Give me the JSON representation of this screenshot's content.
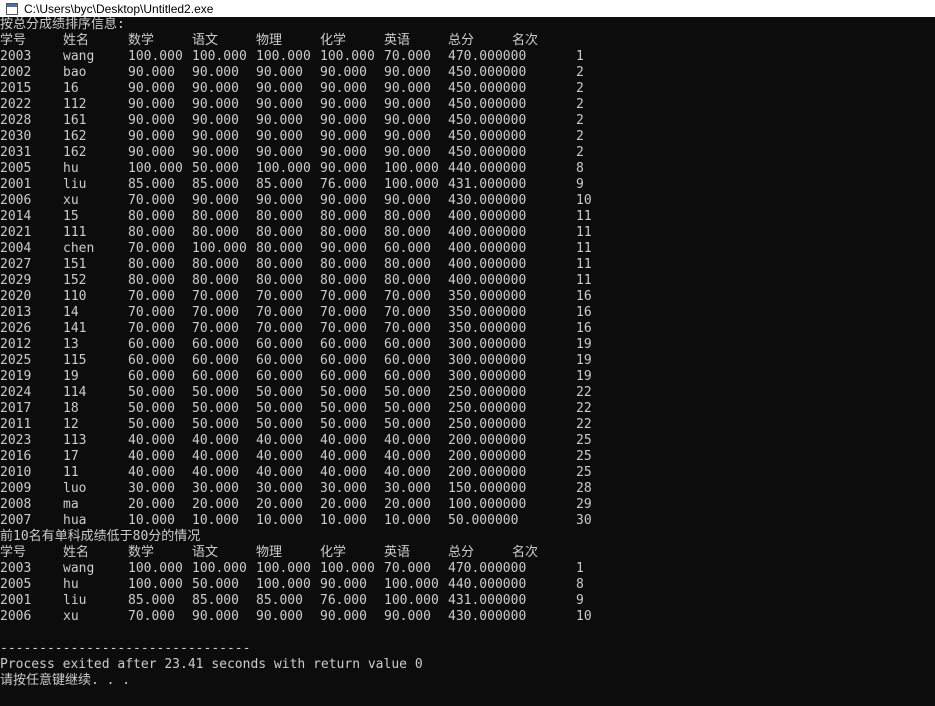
{
  "window": {
    "title": "C:\\Users\\byc\\Desktop\\Untitled2.exe"
  },
  "console": {
    "heading_all": "按总分成绩排序信息:",
    "columns": [
      "学号",
      "姓名",
      "数学",
      "语文",
      "物理",
      "化学",
      "英语",
      "总分",
      "名次"
    ],
    "rows_all": [
      [
        "2003",
        "wang",
        "100.000",
        "100.000",
        "100.000",
        "100.000",
        "70.000",
        "470.000000",
        "1"
      ],
      [
        "2002",
        "bao",
        "90.000",
        "90.000",
        "90.000",
        "90.000",
        "90.000",
        "450.000000",
        "2"
      ],
      [
        "2015",
        "16",
        "90.000",
        "90.000",
        "90.000",
        "90.000",
        "90.000",
        "450.000000",
        "2"
      ],
      [
        "2022",
        "112",
        "90.000",
        "90.000",
        "90.000",
        "90.000",
        "90.000",
        "450.000000",
        "2"
      ],
      [
        "2028",
        "161",
        "90.000",
        "90.000",
        "90.000",
        "90.000",
        "90.000",
        "450.000000",
        "2"
      ],
      [
        "2030",
        "162",
        "90.000",
        "90.000",
        "90.000",
        "90.000",
        "90.000",
        "450.000000",
        "2"
      ],
      [
        "2031",
        "162",
        "90.000",
        "90.000",
        "90.000",
        "90.000",
        "90.000",
        "450.000000",
        "2"
      ],
      [
        "2005",
        "hu",
        "100.000",
        "50.000",
        "100.000",
        "90.000",
        "100.000",
        "440.000000",
        "8"
      ],
      [
        "2001",
        "liu",
        "85.000",
        "85.000",
        "85.000",
        "76.000",
        "100.000",
        "431.000000",
        "9"
      ],
      [
        "2006",
        "xu",
        "70.000",
        "90.000",
        "90.000",
        "90.000",
        "90.000",
        "430.000000",
        "10"
      ],
      [
        "2014",
        "15",
        "80.000",
        "80.000",
        "80.000",
        "80.000",
        "80.000",
        "400.000000",
        "11"
      ],
      [
        "2021",
        "111",
        "80.000",
        "80.000",
        "80.000",
        "80.000",
        "80.000",
        "400.000000",
        "11"
      ],
      [
        "2004",
        "chen",
        "70.000",
        "100.000",
        "80.000",
        "90.000",
        "60.000",
        "400.000000",
        "11"
      ],
      [
        "2027",
        "151",
        "80.000",
        "80.000",
        "80.000",
        "80.000",
        "80.000",
        "400.000000",
        "11"
      ],
      [
        "2029",
        "152",
        "80.000",
        "80.000",
        "80.000",
        "80.000",
        "80.000",
        "400.000000",
        "11"
      ],
      [
        "2020",
        "110",
        "70.000",
        "70.000",
        "70.000",
        "70.000",
        "70.000",
        "350.000000",
        "16"
      ],
      [
        "2013",
        "14",
        "70.000",
        "70.000",
        "70.000",
        "70.000",
        "70.000",
        "350.000000",
        "16"
      ],
      [
        "2026",
        "141",
        "70.000",
        "70.000",
        "70.000",
        "70.000",
        "70.000",
        "350.000000",
        "16"
      ],
      [
        "2012",
        "13",
        "60.000",
        "60.000",
        "60.000",
        "60.000",
        "60.000",
        "300.000000",
        "19"
      ],
      [
        "2025",
        "115",
        "60.000",
        "60.000",
        "60.000",
        "60.000",
        "60.000",
        "300.000000",
        "19"
      ],
      [
        "2019",
        "19",
        "60.000",
        "60.000",
        "60.000",
        "60.000",
        "60.000",
        "300.000000",
        "19"
      ],
      [
        "2024",
        "114",
        "50.000",
        "50.000",
        "50.000",
        "50.000",
        "50.000",
        "250.000000",
        "22"
      ],
      [
        "2017",
        "18",
        "50.000",
        "50.000",
        "50.000",
        "50.000",
        "50.000",
        "250.000000",
        "22"
      ],
      [
        "2011",
        "12",
        "50.000",
        "50.000",
        "50.000",
        "50.000",
        "50.000",
        "250.000000",
        "22"
      ],
      [
        "2023",
        "113",
        "40.000",
        "40.000",
        "40.000",
        "40.000",
        "40.000",
        "200.000000",
        "25"
      ],
      [
        "2016",
        "17",
        "40.000",
        "40.000",
        "40.000",
        "40.000",
        "40.000",
        "200.000000",
        "25"
      ],
      [
        "2010",
        "11",
        "40.000",
        "40.000",
        "40.000",
        "40.000",
        "40.000",
        "200.000000",
        "25"
      ],
      [
        "2009",
        "luo",
        "30.000",
        "30.000",
        "30.000",
        "30.000",
        "30.000",
        "150.000000",
        "28"
      ],
      [
        "2008",
        "ma",
        "20.000",
        "20.000",
        "20.000",
        "20.000",
        "20.000",
        "100.000000",
        "29"
      ],
      [
        "2007",
        "hua",
        "10.000",
        "10.000",
        "10.000",
        "10.000",
        "10.000",
        "50.000000",
        "30"
      ]
    ],
    "heading_top10": "前10名有单科成绩低于80分的情况",
    "rows_top10": [
      [
        "2003",
        "wang",
        "100.000",
        "100.000",
        "100.000",
        "100.000",
        "70.000",
        "470.000000",
        "1"
      ],
      [
        "2005",
        "hu",
        "100.000",
        "50.000",
        "100.000",
        "90.000",
        "100.000",
        "440.000000",
        "8"
      ],
      [
        "2001",
        "liu",
        "85.000",
        "85.000",
        "85.000",
        "76.000",
        "100.000",
        "431.000000",
        "9"
      ],
      [
        "2006",
        "xu",
        "70.000",
        "90.000",
        "90.000",
        "90.000",
        "90.000",
        "430.000000",
        "10"
      ]
    ],
    "separator": "--------------------------------",
    "exit_message": "Process exited after 23.41 seconds with return value 0",
    "continue_prompt": "请按任意键继续. . ."
  }
}
